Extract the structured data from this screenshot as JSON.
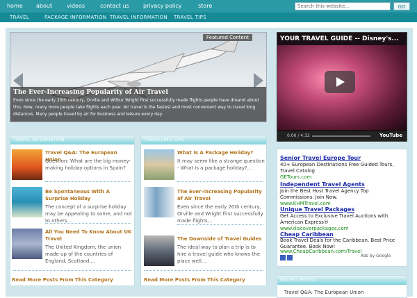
{
  "topnav": {
    "items": [
      "home",
      "about",
      "videos",
      "contact us",
      "privacy policy",
      "store"
    ],
    "search_placeholder": "Search this website...",
    "go_label": "GO"
  },
  "subnav": {
    "items": [
      "TRAVEL",
      "PACKAGE INFORMATION",
      "TRAVEL INFORMATION",
      "TRAVEL TIPS"
    ]
  },
  "featured": {
    "tag": "Featured Content",
    "title": "The Ever-Increasing Popularity of Air Travel",
    "text": "Even since the early 20th century, Orville and Wilbur Wright first successfully made flights people have dreamt about this. Now, many more people take flights each year. Air travel is the fastest and most convenient way to travel long distances. Many people travel by air for business and leisure every day."
  },
  "video": {
    "title": "YOUR TRAVEL GUIDE -- Disney's...",
    "time": "0:00 / 4:32",
    "brand": "YouTube"
  },
  "travel_info": {
    "header": "TRAVEL INFORMATION",
    "posts": [
      {
        "title": "Travel Q&A: The European Union",
        "text": "Question: What are the big money-making holiday options in Spain?"
      },
      {
        "title": "Be Spontaneous With A Surprise Holiday",
        "text": "The concept of a surprise holiday may be appealing to some, and not to others..."
      },
      {
        "title": "All You Need To Know About UK Travel",
        "text": "The United Kingdom, the union made up of the countries of England, Scotland,..."
      }
    ],
    "read_more": "Read More Posts From This Category"
  },
  "travel_tips": {
    "header": "TRAVELLING TIPS",
    "posts": [
      {
        "title": "What Is A Package Holiday?",
        "text": "It may seem like a strange question - What is a package holiday?..."
      },
      {
        "title": "The Ever-Increasing Popularity of Air Travel",
        "text": "Even since the early 20th century, Orville and Wright first successfully made flights..."
      },
      {
        "title": "The Downside of Travel Guides",
        "text": "The ideal way to plan a trip is to hire a travel guide who knows the place well..."
      }
    ],
    "read_more": "Read More Posts From This Category"
  },
  "ads": {
    "items": [
      {
        "title": "Senior Travel Europe Tour",
        "text": "40+ European Destinations Free Guided Tours, Travel Catalog",
        "url": "GETours.com"
      },
      {
        "title": "Independent Travel Agents",
        "text": "Join the Best Host Travel Agency Top Commissions. Join Now.",
        "url": "www.KHMTravel.com"
      },
      {
        "title": "Unique Travel Packages",
        "text": "Get Access to Exclusive Travel Auctions with American Express®",
        "url": "www.discoverpackages.com"
      },
      {
        "title": "Cheap Caribbean",
        "text": "Book Travel Deals for the Caribbean. Best Price Guarantee. Book Now!",
        "url": "www.CheapCaribbean.com/Travel"
      }
    ],
    "by": "Ads by Google"
  },
  "recent": {
    "header": "RECENT POSTS",
    "first": "Travel Q&A: The European Union"
  },
  "colors": {
    "nav": "#2a9aa6",
    "subnav": "#168a97",
    "accent_link": "#b1741d",
    "ad_link": "#1a2aa8",
    "ad_url": "#1b8a1b"
  }
}
